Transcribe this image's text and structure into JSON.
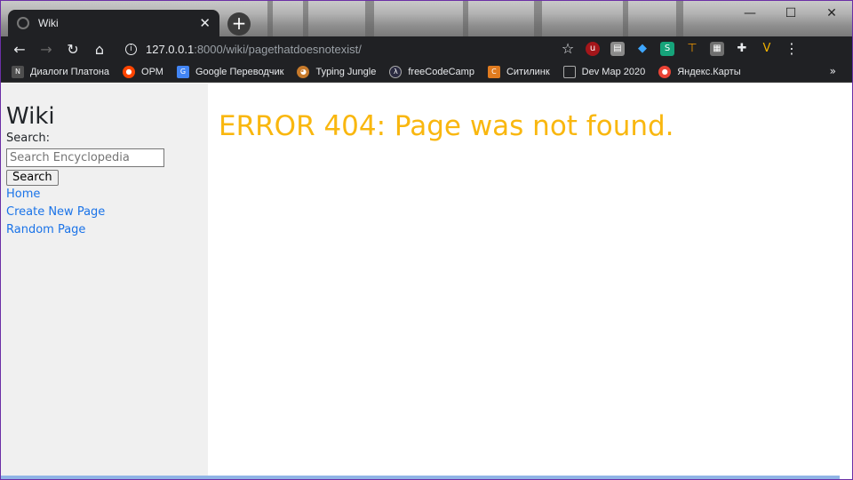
{
  "browser": {
    "tab": {
      "title": "Wiki",
      "close_glyph": "✕"
    },
    "new_tab_glyph": "+",
    "window_controls": {
      "minimize": "—",
      "maximize": "☐",
      "close": "✕"
    },
    "toolbar": {
      "back_glyph": "←",
      "forward_glyph": "→",
      "reload_glyph": "↻",
      "home_glyph": "⌂",
      "url_host": "127.0.0.1",
      "url_path": ":8000/wiki/pagethatdoesnotexist/",
      "star_glyph": "☆",
      "menu_glyph": "⋮"
    },
    "extensions": [
      "ublock-icon",
      "wallet-icon",
      "diamond-icon",
      "sheets-icon",
      "pickaxe-icon",
      "grid-icon",
      "puzzle-icon",
      "vue-icon"
    ],
    "bookmarks": [
      {
        "label": "Диалоги Платона",
        "icon": "npm-icon",
        "color": "#4f4f4f"
      },
      {
        "label": "ОРМ",
        "icon": "reddit-icon",
        "color": "#ff4500"
      },
      {
        "label": "Google Переводчик",
        "icon": "translate-icon",
        "color": "#4285f4"
      },
      {
        "label": "Typing Jungle",
        "icon": "monkey-icon",
        "color": "#c77a2b"
      },
      {
        "label": "freeCodeCamp",
        "icon": "fcc-icon",
        "color": "#2a2a40"
      },
      {
        "label": "Ситилинк",
        "icon": "citilink-icon",
        "color": "#e07b1f"
      },
      {
        "label": "Dev Map 2020",
        "icon": "screen-icon",
        "color": "#555555"
      },
      {
        "label": "Яндекс.Карты",
        "icon": "map-pin-icon",
        "color": "#ea4335"
      }
    ],
    "bookmarks_more": "»"
  },
  "sidebar": {
    "title": "Wiki",
    "search_label": "Search:",
    "search_placeholder": "Search Encyclopedia",
    "search_button": "Search",
    "links": [
      "Home",
      "Create New Page",
      "Random Page"
    ]
  },
  "main": {
    "error_heading": "ERROR 404: Page was not found."
  },
  "colors": {
    "error": "#f9b70f",
    "link": "#1a73e8",
    "sidebar_bg": "#f0f0f0",
    "chrome_dark": "#202124"
  }
}
